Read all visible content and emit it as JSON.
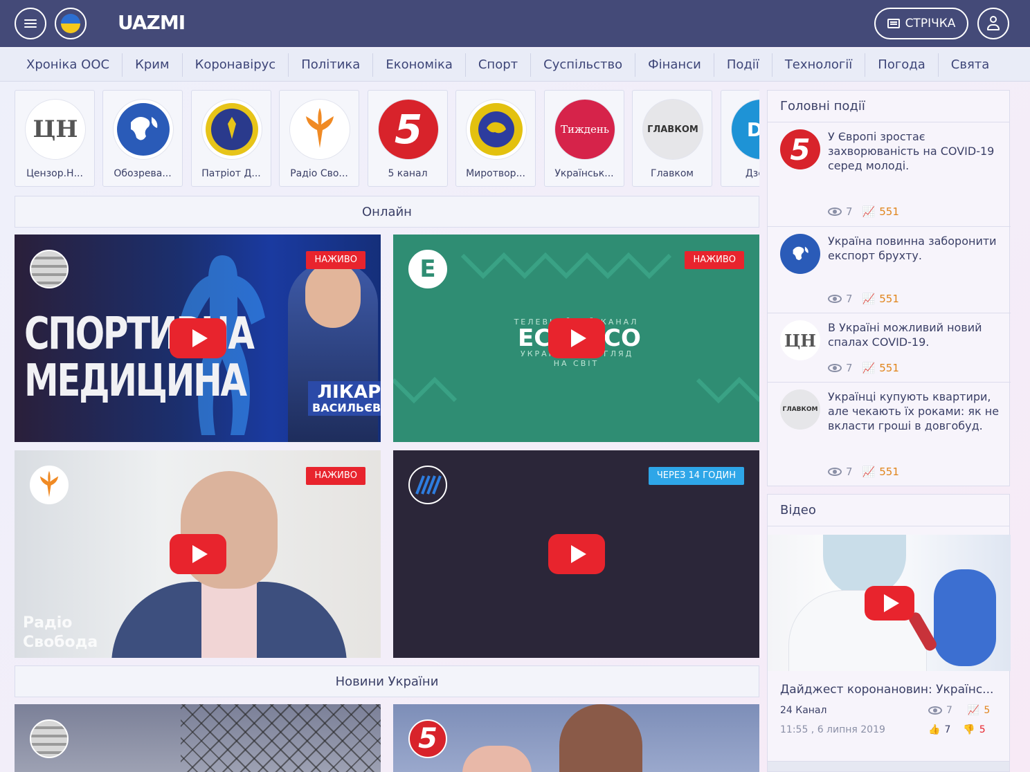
{
  "header": {
    "logo": "UAZMI",
    "feed_label": "СТРІЧКА"
  },
  "categories": [
    "Хроніка ООС",
    "Крим",
    "Коронавірус",
    "Політика",
    "Економіка",
    "Спорт",
    "Суспільство",
    "Фінанси",
    "Події",
    "Технології",
    "Погода",
    "Свята"
  ],
  "sources": [
    {
      "name": "Цензор.Н...",
      "logo_text": "ЦН"
    },
    {
      "name": "Обозрева...",
      "logo_text": ""
    },
    {
      "name": "Патріот Д...",
      "logo_text": ""
    },
    {
      "name": "Радіо Сво...",
      "logo_text": ""
    },
    {
      "name": "5 канал",
      "logo_text": "5"
    },
    {
      "name": "Миротвор...",
      "logo_text": ""
    },
    {
      "name": "Українськ...",
      "logo_text": "Тиждень"
    },
    {
      "name": "Главком",
      "logo_text": "ГЛАВКОМ"
    },
    {
      "name": "Дзерк",
      "logo_text": "DT"
    }
  ],
  "online": {
    "title": "Онлайн",
    "tiles": [
      {
        "badge": "НАЖИВО",
        "overlay_line1": "СПОРТИВНА",
        "overlay_line2": "МЕДИЦИНА",
        "caption_line1": "ЛІКАР",
        "caption_line2": "ВАСИЛЬЄВ"
      },
      {
        "badge": "НАЖИВО",
        "channel_letter": "E",
        "overlay_top": "ТЕЛЕВІЗІЙНИЙ КАНАЛ",
        "overlay_logo": "ECO",
        "overlay_logo_end": "CO",
        "overlay_sub_left": "УКРАЇ",
        "overlay_sub_right": "ГЛЯД",
        "overlay_bottom": "НА СВІТ"
      },
      {
        "badge": "НАЖИВО",
        "caption_line1": "Радіо",
        "caption_line2": "Свобода"
      },
      {
        "badge": "ЧЕРЕЗ 14 ГОДИН"
      }
    ]
  },
  "news_ukraine": {
    "title": "Новини України",
    "tile2_channel": "5"
  },
  "main_events": {
    "title": "Головні події",
    "items": [
      {
        "logo_text": "5",
        "text": "У Європі зростає захворюваність на COVID-19 серед молоді.",
        "views": "7",
        "trend": "551"
      },
      {
        "logo_text": "",
        "text": "Україна повинна заборонити експорт брухту.",
        "views": "7",
        "trend": "551"
      },
      {
        "logo_text": "ЦН",
        "text": "В Україні можливий новий спалах COVID-19.",
        "views": "7",
        "trend": "551"
      },
      {
        "logo_text": "ГЛАВКОМ",
        "text": "Українці купують квартири, але чекають їх роками: як не вкласти гроші в довгобуд.",
        "views": "7",
        "trend": "551"
      }
    ]
  },
  "video": {
    "title": "Відео",
    "item_title": "Дайджест коронановин: Українс...",
    "source": "24 Канал",
    "time": "11:55 , 6 липня 2019",
    "views": "7",
    "trend": "5",
    "likes": "7",
    "dislikes": "5"
  },
  "colors": {
    "header_bg": "#444a78",
    "accent_red": "#e8242d",
    "accent_orange": "#e0841a",
    "accent_blue": "#2ea6e8"
  }
}
